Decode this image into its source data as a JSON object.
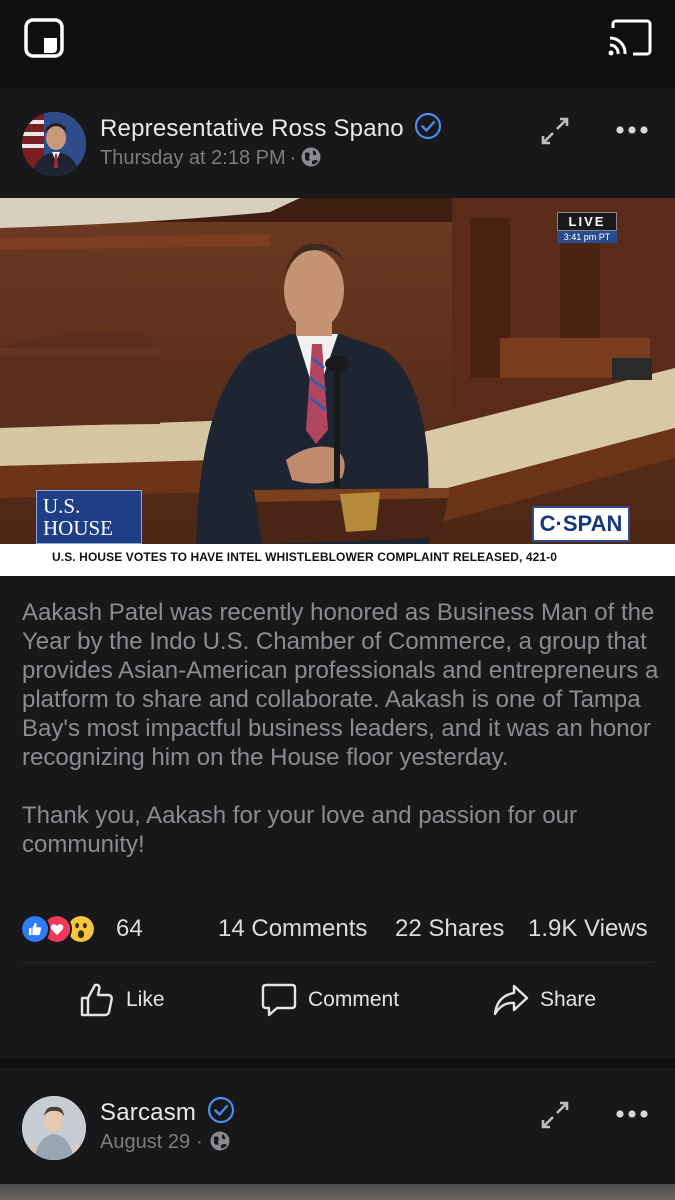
{
  "post": {
    "author": "Representative Ross Spano",
    "verified": true,
    "timestamp": "Thursday at 2:18 PM",
    "separator": "·",
    "audience_icon": "globe-icon",
    "video": {
      "live_label": "LIVE",
      "live_time": "3:41 pm PT",
      "house_logo_line1": "U.S.",
      "house_logo_line2": "HOUSE",
      "network_logo": "C·SPAN",
      "chyron": "U.S. HOUSE VOTES TO HAVE INTEL WHISTLEBLOWER COMPLAINT RELEASED, 421-0"
    },
    "caption_p1": "Aakash Patel was recently honored as Business Man of the Year by the Indo U.S. Chamber of Commerce, a group that provides Asian-American professionals and entrepreneurs a platform to share and collaborate. Aakash is one of Tampa Bay's most impactful business leaders, and it was an honor recognizing him on the House floor yesterday.",
    "caption_p2": "Thank you, Aakash for your love and passion for our community!",
    "stats": {
      "reactions": "64",
      "comments": "14 Comments",
      "shares": "22 Shares",
      "views": "1.9K Views"
    },
    "actions": {
      "like": "Like",
      "comment": "Comment",
      "share": "Share"
    }
  },
  "next_post": {
    "author": "Sarcasm",
    "verified": true,
    "timestamp": "August 29",
    "separator": "·",
    "audience_icon": "globe-icon"
  },
  "colors": {
    "background": "#0f0f10",
    "card": "#18181a",
    "verified_blue": "#4a8cf0",
    "like_blue": "#2f7cf6",
    "love_red": "#f0385a",
    "wow_yellow": "#f7c63d"
  }
}
